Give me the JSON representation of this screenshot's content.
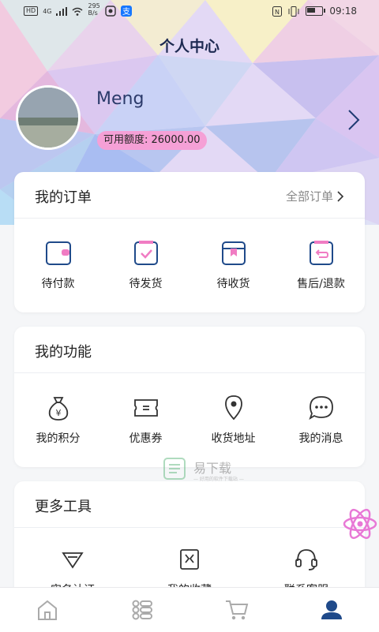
{
  "status_bar": {
    "network": "4G",
    "speed_value": "295",
    "speed_unit": "B/s",
    "time": "09:18"
  },
  "header": {
    "title": "个人中心"
  },
  "profile": {
    "username": "Meng",
    "credit_label": "可用额度: 26000.00"
  },
  "orders": {
    "title": "我的订单",
    "view_all": "全部订单",
    "items": [
      {
        "label": "待付款",
        "icon": "wallet-icon"
      },
      {
        "label": "待发货",
        "icon": "clipboard-check-icon"
      },
      {
        "label": "待收货",
        "icon": "box-icon"
      },
      {
        "label": "售后/退款",
        "icon": "clipboard-return-icon"
      }
    ]
  },
  "features": {
    "title": "我的功能",
    "items": [
      {
        "label": "我的积分",
        "icon": "money-bag-icon"
      },
      {
        "label": "优惠券",
        "icon": "coupon-icon"
      },
      {
        "label": "收货地址",
        "icon": "location-pin-icon"
      },
      {
        "label": "我的消息",
        "icon": "chat-bubble-icon"
      }
    ]
  },
  "tools": {
    "title": "更多工具",
    "items": [
      {
        "label": "实名认证",
        "icon": "diamond-badge-icon"
      },
      {
        "label": "我的收藏",
        "icon": "bookmark-icon"
      },
      {
        "label": "联系客服",
        "icon": "headset-icon"
      }
    ]
  },
  "watermark": {
    "title": "易下载",
    "subtitle": "— 好用的软件下载站 —"
  },
  "tabbar": {
    "items": [
      {
        "icon": "home-icon"
      },
      {
        "icon": "category-icon"
      },
      {
        "icon": "cart-icon"
      },
      {
        "icon": "profile-icon"
      }
    ]
  },
  "colors": {
    "accent": "#1f4a8a",
    "credit_badge": "#f5a0d6",
    "float_button": "#e879d6",
    "title": "#1e2a52"
  }
}
